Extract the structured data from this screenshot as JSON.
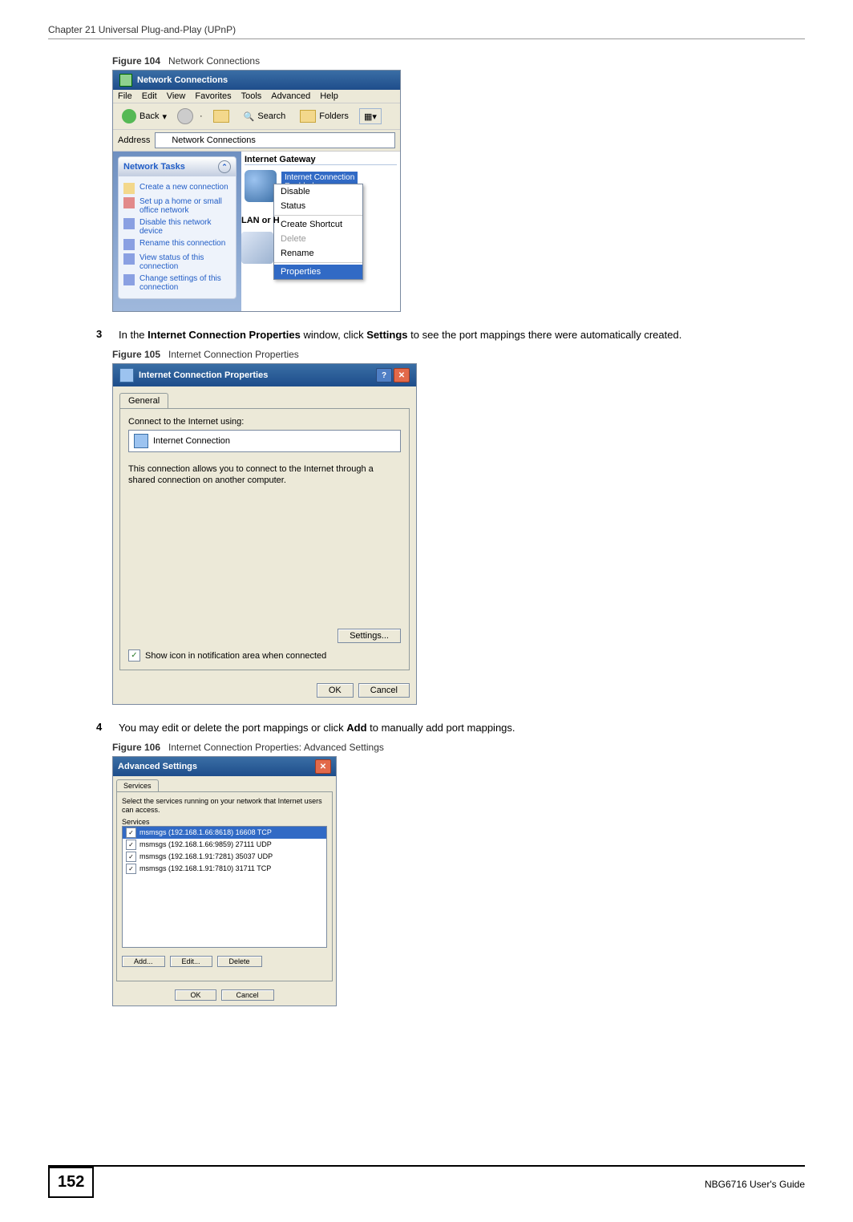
{
  "header": {
    "chapter": "Chapter 21 Universal Plug-and-Play (UPnP)"
  },
  "fig104": {
    "caption_num": "Figure 104",
    "caption_text": "Network Connections",
    "titlebar": "Network Connections",
    "menus": [
      "File",
      "Edit",
      "View",
      "Favorites",
      "Tools",
      "Advanced",
      "Help"
    ],
    "toolbar": {
      "back": "Back",
      "search": "Search",
      "folders": "Folders"
    },
    "address_label": "Address",
    "address_value": "Network Connections",
    "task_header": "Network Tasks",
    "tasks": [
      "Create a new connection",
      "Set up a home or small office network",
      "Disable this network device",
      "Rename this connection",
      "View status of this connection",
      "Change settings of this connection"
    ],
    "group_header": "Internet Gateway",
    "ig_label": "Internet Connection\nEnabled\nInternet Connection",
    "lan_label": "LAN or H",
    "ctx_items": {
      "disable": "Disable",
      "status": "Status",
      "create_shortcut": "Create Shortcut",
      "delete": "Delete",
      "rename": "Rename",
      "properties": "Properties"
    }
  },
  "step3": {
    "num": "3",
    "text_pre": "In the ",
    "bold1": "Internet Connection Properties",
    "text_mid": " window, click ",
    "bold2": "Settings",
    "text_post": " to see the port mappings there were automatically created."
  },
  "fig105": {
    "caption_num": "Figure 105",
    "caption_text": "Internet Connection Properties",
    "titlebar": "Internet Connection Properties",
    "tab": "General",
    "connect_label": "Connect to the Internet using:",
    "conn_name": "Internet Connection",
    "desc": "This connection allows you to connect to the Internet through a shared connection on another computer.",
    "settings_btn": "Settings...",
    "show_icon": "Show icon in notification area when connected",
    "ok": "OK",
    "cancel": "Cancel"
  },
  "step4": {
    "num": "4",
    "text_pre": "You may edit or delete the port mappings or click ",
    "bold1": "Add",
    "text_post": " to manually add port mappings."
  },
  "fig106": {
    "caption_num": "Figure 106",
    "caption_text": "Internet Connection Properties: Advanced Settings",
    "titlebar": "Advanced Settings",
    "tab": "Services",
    "desc": "Select the services running on your network that Internet users can access.",
    "services_label": "Services",
    "items": [
      "msmsgs (192.168.1.66:8618) 16608 TCP",
      "msmsgs (192.168.1.66:9859) 27111 UDP",
      "msmsgs (192.168.1.91:7281) 35037 UDP",
      "msmsgs (192.168.1.91:7810) 31711 TCP"
    ],
    "add": "Add...",
    "edit": "Edit...",
    "delete": "Delete",
    "ok": "OK",
    "cancel": "Cancel"
  },
  "footer": {
    "page": "152",
    "guide": "NBG6716 User's Guide"
  }
}
